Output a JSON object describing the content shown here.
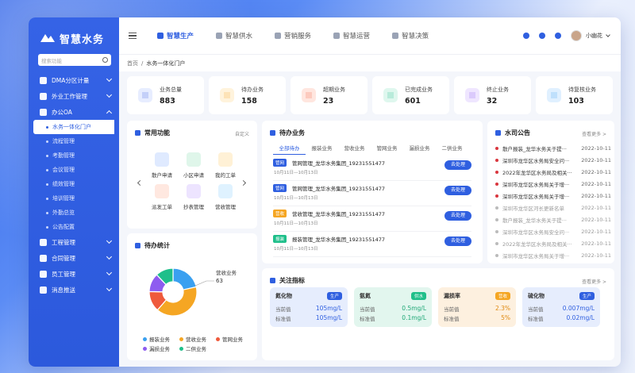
{
  "app": {
    "name": "智慧水务"
  },
  "sidebar": {
    "search_placeholder": "搜索功能",
    "items": [
      {
        "label": "DMA分区计量",
        "expanded": false
      },
      {
        "label": "外业工作管理",
        "expanded": false
      },
      {
        "label": "办公OA",
        "expanded": true
      }
    ],
    "subitems": [
      "水务一体化门户",
      "流程管理",
      "考勤管理",
      "会议管理",
      "绩效管理",
      "培训管理",
      "外勤总览",
      "公告配置"
    ],
    "items2": [
      "工程管理",
      "合同管理",
      "员工管理",
      "消息推送"
    ]
  },
  "topbar": {
    "tabs": [
      "智慧生产",
      "智慧供水",
      "营销服务",
      "智慧运营",
      "智慧决策"
    ],
    "active_tab": 0,
    "user": "小幽花"
  },
  "breadcrumb": {
    "home": "首页",
    "sep": "/",
    "current": "水务一体化门户"
  },
  "stats": [
    {
      "label": "业务总量",
      "value": "883",
      "color": "#3b5fe0",
      "bg": "#e7edff"
    },
    {
      "label": "待办业务",
      "value": "158",
      "color": "#f5a623",
      "bg": "#fff3dc"
    },
    {
      "label": "超期业务",
      "value": "23",
      "color": "#ef5a3c",
      "bg": "#ffe6df"
    },
    {
      "label": "已完成业务",
      "value": "601",
      "color": "#1fbf8a",
      "bg": "#dff7ee"
    },
    {
      "label": "终止业务",
      "value": "32",
      "color": "#8e5cf0",
      "bg": "#efe6ff"
    },
    {
      "label": "待复核业务",
      "value": "103",
      "color": "#3aa0f0",
      "bg": "#e0f0ff"
    }
  ],
  "quick": {
    "title": "常用功能",
    "customize": "自定义",
    "items": [
      {
        "label": "散户申请",
        "color": "#dfeaff"
      },
      {
        "label": "小区申请",
        "color": "#dff6ea"
      },
      {
        "label": "我的工单",
        "color": "#fff1d6"
      },
      {
        "label": "派发工单",
        "color": "#ffe8e0"
      },
      {
        "label": "抄表管理",
        "color": "#ede4ff"
      },
      {
        "label": "营收管理",
        "color": "#dff2ff"
      }
    ]
  },
  "todo": {
    "title": "待办业务",
    "tabs": [
      "全部待办",
      "报装业务",
      "营收业务",
      "管网业务",
      "漏损业务",
      "二供业务"
    ],
    "active_tab": 0,
    "action": "去处理",
    "rows": [
      {
        "badge": "管网",
        "badge_color": "#2f5fe0",
        "title": "管网管理_龙华水务集团_19231551477",
        "date": "10月11日—10月13日"
      },
      {
        "badge": "管网",
        "badge_color": "#2f5fe0",
        "title": "管网管理_龙华水务集团_19231551477",
        "date": "10月11日—10月13日"
      },
      {
        "badge": "营收",
        "badge_color": "#f5a623",
        "title": "营收管理_龙华水务集团_19231551477",
        "date": "10月11日—10月13日"
      },
      {
        "badge": "报装",
        "badge_color": "#1fbf8a",
        "title": "报装管理_龙华水务集团_19231551477",
        "date": "10月11日—10月13日"
      }
    ]
  },
  "notices": {
    "title": "水司公告",
    "more": "查看更多 >",
    "items": [
      {
        "text": "散户报装_龙华水务关于提···",
        "date": "2022-10-11",
        "read": false
      },
      {
        "text": "深圳市龙华区水务局安全问···",
        "date": "2022-10-11",
        "read": false
      },
      {
        "text": "2022年龙华区水务局及相关···",
        "date": "2022-10-11",
        "read": false
      },
      {
        "text": "深圳市龙华区水务局关于增···",
        "date": "2022-10-11",
        "read": false
      },
      {
        "text": "深圳市龙华区水务局关于增···",
        "date": "2022-10-11",
        "read": false
      },
      {
        "text": "深圳市龙华区河长更新名单",
        "date": "2022-10-11",
        "read": true
      },
      {
        "text": "散户报装_龙华水务关于提···",
        "date": "2022-10-11",
        "read": true
      },
      {
        "text": "深圳市龙华区水务局安全问···",
        "date": "2022-10-11",
        "read": true
      },
      {
        "text": "2022年龙华区水务局及相关···",
        "date": "2022-10-11",
        "read": true
      },
      {
        "text": "深圳市龙华区水务局关于增···",
        "date": "2022-10-11",
        "read": true
      }
    ]
  },
  "todo_stats": {
    "title": "待办统计",
    "callout": {
      "label": "营收业务",
      "value": "63"
    }
  },
  "chart_data": {
    "type": "pie",
    "categories": [
      "报装业务",
      "营收业务",
      "管网业务",
      "漏损业务",
      "二供业务"
    ],
    "values": [
      34,
      63,
      22,
      20,
      19
    ],
    "colors": [
      "#3aa0f0",
      "#f5a623",
      "#ef5a3c",
      "#8e5cf0",
      "#1fbf8a"
    ],
    "donut": true,
    "legend": "bottom"
  },
  "indicators": {
    "title": "关注指标",
    "more": "查看更多 >",
    "current_label": "当前值",
    "standard_label": "标准值",
    "items": [
      {
        "name": "氮化物",
        "tag": "生产",
        "tag_color": "#2f5fe0",
        "bg": "#e6edfd",
        "current": "105mg/L",
        "standard": "105mg/L",
        "vcolor": "#2f5fe0"
      },
      {
        "name": "氨氮",
        "tag": "供水",
        "tag_color": "#1fbf8a",
        "bg": "#e2f6ee",
        "current": "0.5mg/L",
        "standard": "0.1mg/L",
        "vcolor": "#1fa877"
      },
      {
        "name": "漏损率",
        "tag": "营收",
        "tag_color": "#f5a623",
        "bg": "#fdf0df",
        "current": "2.3%",
        "standard": "5%",
        "vcolor": "#e08a12"
      },
      {
        "name": "硫化物",
        "tag": "生产",
        "tag_color": "#2f5fe0",
        "bg": "#e6edfd",
        "current": "0.007mg/L",
        "standard": "0.02mg/L",
        "vcolor": "#2f5fe0"
      }
    ]
  }
}
